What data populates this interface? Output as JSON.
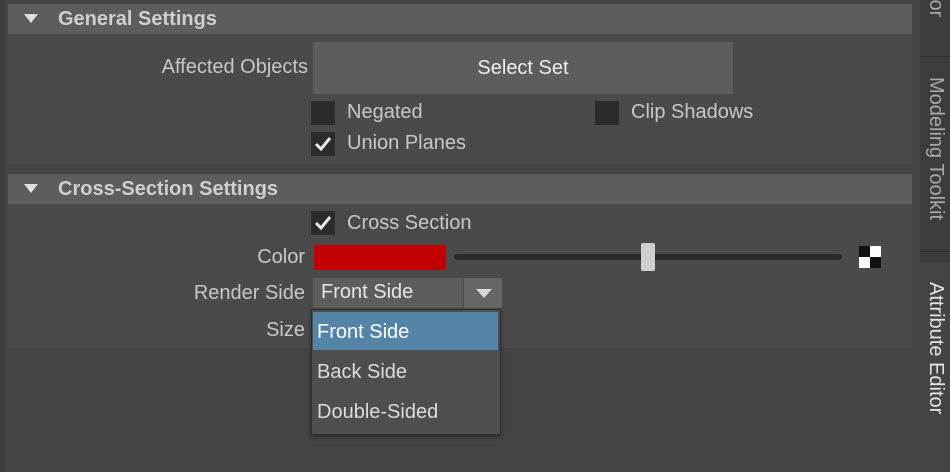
{
  "general": {
    "header": "General Settings",
    "affected_objects_label": "Affected Objects",
    "select_set_button": "Select Set",
    "negated": {
      "label": "Negated",
      "checked": false
    },
    "clip_shadows": {
      "label": "Clip Shadows",
      "checked": false
    },
    "union_planes": {
      "label": "Union Planes",
      "checked": true
    }
  },
  "cross_section": {
    "header": "Cross-Section Settings",
    "cross_section": {
      "label": "Cross Section",
      "checked": true
    },
    "color_label": "Color",
    "color_value": "#c30000",
    "color_slider_value": 0.5,
    "render_side_label": "Render Side",
    "render_side_value": "Front Side",
    "size_label": "Size",
    "render_side_options": [
      "Front Side",
      "Back Side",
      "Double-Sided"
    ],
    "selected_option_index": 0
  },
  "side_tabs": [
    "tor",
    "Modeling Toolkit",
    "Attribute Editor"
  ],
  "active_side_tab": "Attribute Editor",
  "colors": {
    "background": "#444444",
    "header_bg": "#5d5d5d",
    "selection": "#5485a8"
  }
}
